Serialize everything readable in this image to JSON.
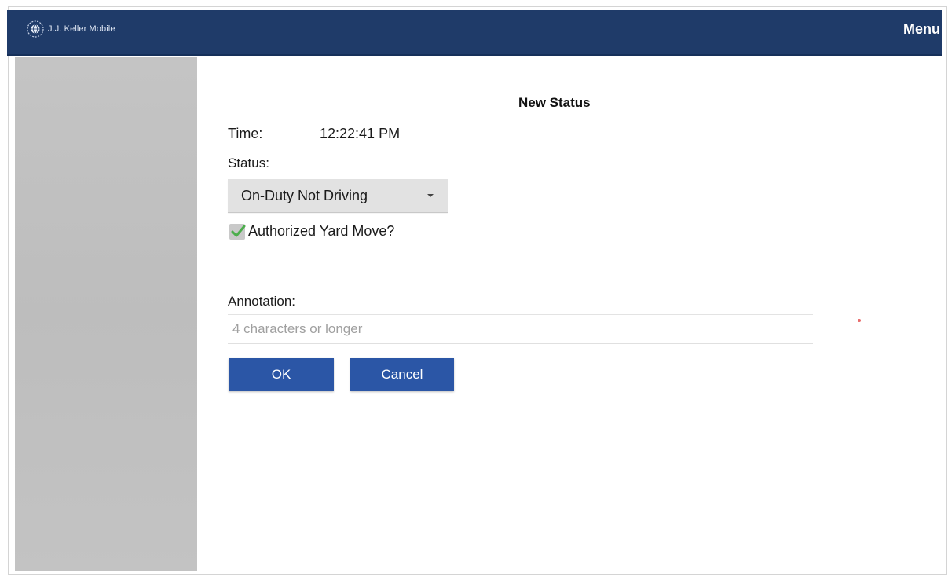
{
  "header": {
    "app_name": "J.J. Keller Mobile",
    "menu_label": "Menu",
    "logo_icon": "globe-logo-icon",
    "background_color": "#1f3b69"
  },
  "dialog": {
    "title": "New Status",
    "time_label": "Time:",
    "time_value": "12:22:41 PM",
    "status_label": "Status:",
    "status_selected": "On-Duty Not Driving",
    "yard_move": {
      "label": "Authorized Yard Move?",
      "checked": true
    },
    "annotation_label": "Annotation:",
    "annotation_value": "",
    "annotation_placeholder": "4 characters or longer",
    "ok_label": "OK",
    "cancel_label": "Cancel",
    "button_color": "#2b56a6"
  }
}
